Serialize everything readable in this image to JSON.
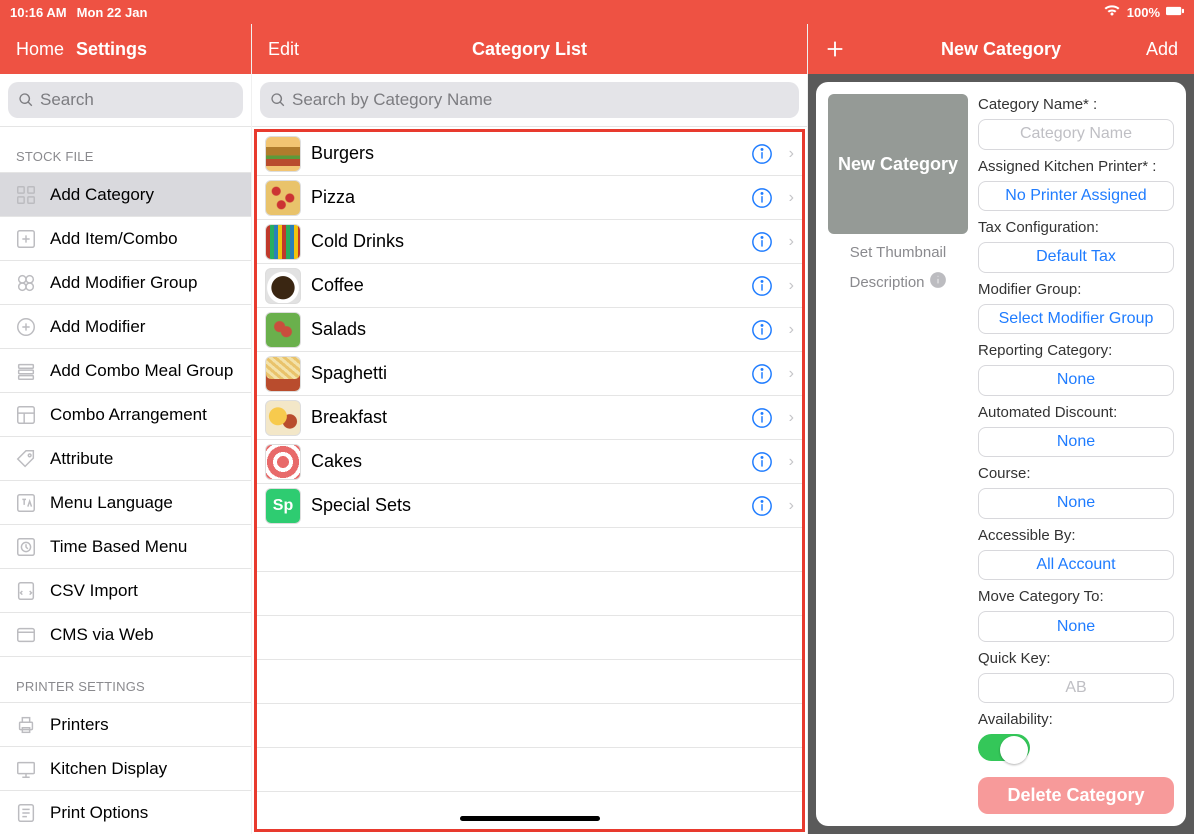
{
  "status": {
    "time": "10:16 AM",
    "date": "Mon 22 Jan",
    "battery": "100%"
  },
  "leftNav": {
    "home": "Home",
    "settings": "Settings"
  },
  "leftSearch": {
    "placeholder": "Search"
  },
  "sections": {
    "stock_file": {
      "title": "STOCK FILE",
      "items": [
        {
          "label": "Add Category",
          "icon": "grid",
          "selected": true
        },
        {
          "label": "Add Item/Combo",
          "icon": "plus-square"
        },
        {
          "label": "Add Modifier Group",
          "icon": "circles"
        },
        {
          "label": "Add Modifier",
          "icon": "plus-circle"
        },
        {
          "label": "Add Combo Meal Group",
          "icon": "stack"
        },
        {
          "label": "Combo Arrangement",
          "icon": "layout"
        },
        {
          "label": "Attribute",
          "icon": "tag"
        },
        {
          "label": "Menu Language",
          "icon": "lang"
        },
        {
          "label": "Time Based Menu",
          "icon": "clock"
        },
        {
          "label": "CSV Import",
          "icon": "csv"
        },
        {
          "label": "CMS via Web",
          "icon": "web"
        }
      ]
    },
    "printer_settings": {
      "title": "PRINTER SETTINGS",
      "items": [
        {
          "label": "Printers",
          "icon": "printer"
        },
        {
          "label": "Kitchen Display",
          "icon": "display"
        },
        {
          "label": "Print Options",
          "icon": "options"
        }
      ]
    }
  },
  "midNav": {
    "edit": "Edit",
    "title": "Category List"
  },
  "midSearch": {
    "placeholder": "Search by Category Name"
  },
  "categories": [
    {
      "label": "Burgers",
      "thumb": "thumb-burger"
    },
    {
      "label": "Pizza",
      "thumb": "thumb-pizza"
    },
    {
      "label": "Cold Drinks",
      "thumb": "thumb-colddrinks"
    },
    {
      "label": "Coffee",
      "thumb": "thumb-coffee"
    },
    {
      "label": "Salads",
      "thumb": "thumb-salads"
    },
    {
      "label": "Spaghetti",
      "thumb": "thumb-spaghetti"
    },
    {
      "label": "Breakfast",
      "thumb": "thumb-breakfast"
    },
    {
      "label": "Cakes",
      "thumb": "thumb-cakes"
    },
    {
      "label": "Special Sets",
      "thumb": "thumb-specialsets",
      "badge": "Sp"
    }
  ],
  "rightNav": {
    "title": "New Category",
    "add": "Add"
  },
  "rightPanel": {
    "thumb_title": "New Category",
    "thumb_label": "Set Thumbnail",
    "thumb_desc": "Description",
    "fields": {
      "category_name": {
        "label": "Category Name* :",
        "placeholder": "Category Name"
      },
      "printer": {
        "label": "Assigned Kitchen Printer* :",
        "value": "No Printer Assigned"
      },
      "tax": {
        "label": "Tax Configuration:",
        "value": "Default Tax"
      },
      "modifier": {
        "label": "Modifier Group:",
        "value": "Select Modifier Group"
      },
      "reporting": {
        "label": "Reporting Category:",
        "value": "None"
      },
      "discount": {
        "label": "Automated Discount:",
        "value": "None"
      },
      "course": {
        "label": "Course:",
        "value": "None"
      },
      "accessible": {
        "label": "Accessible By:",
        "value": "All Account"
      },
      "move": {
        "label": "Move Category To:",
        "value": "None"
      },
      "quickkey": {
        "label": "Quick Key:",
        "placeholder": "AB"
      },
      "availability": {
        "label": "Availability:"
      }
    },
    "delete": "Delete Category"
  }
}
